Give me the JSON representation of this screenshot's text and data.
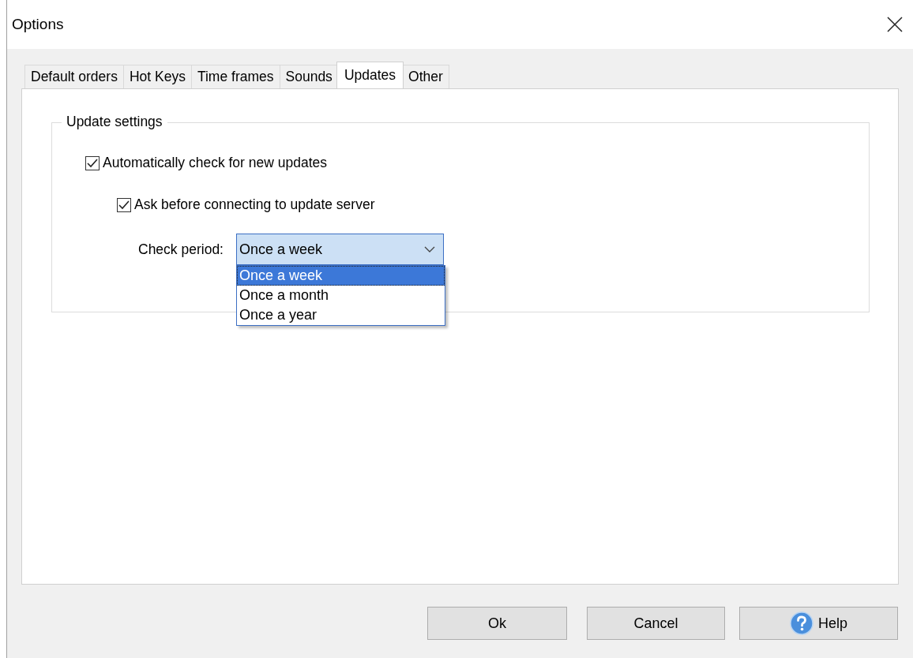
{
  "window": {
    "title": "Options"
  },
  "tabs": [
    {
      "label": "Default orders",
      "selected": false
    },
    {
      "label": "Hot Keys",
      "selected": false
    },
    {
      "label": "Time frames",
      "selected": false
    },
    {
      "label": "Sounds",
      "selected": false
    },
    {
      "label": "Updates",
      "selected": true
    },
    {
      "label": "Other",
      "selected": false
    }
  ],
  "group": {
    "title": "Update settings",
    "auto_check": {
      "label": "Automatically check for new updates",
      "checked": true
    },
    "ask_before": {
      "label": "Ask before connecting to update server",
      "checked": true
    },
    "check_period": {
      "label": "Check period:",
      "value": "Once a week",
      "expanded": true,
      "options": [
        {
          "label": "Once a week",
          "selected": true
        },
        {
          "label": "Once a month",
          "selected": false
        },
        {
          "label": "Once a year",
          "selected": false
        }
      ]
    }
  },
  "buttons": [
    {
      "label": "Ok",
      "kind": "plain"
    },
    {
      "label": "Cancel",
      "kind": "plain"
    },
    {
      "label": "Help",
      "kind": "help"
    }
  ]
}
